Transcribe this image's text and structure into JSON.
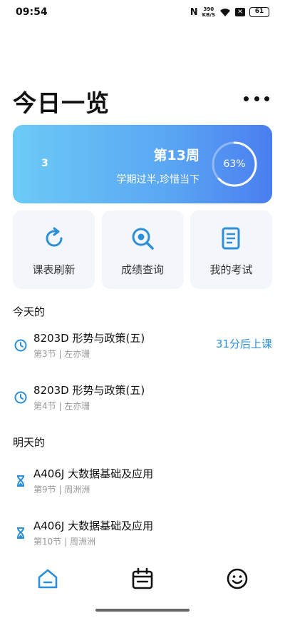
{
  "status_bar": {
    "time": "09:54",
    "nfc": "N",
    "speed_value": "390",
    "speed_unit": "KB/S",
    "battery": "61"
  },
  "page_title": "今日一览",
  "week_card": {
    "left_number": "3",
    "week_label": "第13周",
    "subtitle": "学期过半,珍惜当下",
    "progress_text": "63%",
    "progress_value": 0.63
  },
  "quick_actions": [
    {
      "label": "课表刷新",
      "icon": "refresh-icon"
    },
    {
      "label": "成绩查询",
      "icon": "search-icon"
    },
    {
      "label": "我的考试",
      "icon": "document-icon"
    }
  ],
  "today": {
    "title": "今天的",
    "courses": [
      {
        "name": "8203D 形势与政策(五)",
        "meta": "第3节 | 左亦珊",
        "status": "31分后上课",
        "icon": "clock-icon"
      },
      {
        "name": "8203D 形势与政策(五)",
        "meta": "第4节 | 左亦珊",
        "status": "",
        "icon": "clock-icon"
      }
    ]
  },
  "tomorrow": {
    "title": "明天的",
    "courses": [
      {
        "name": "A406J 大数据基础及应用",
        "meta": "第9节 | 周洲洲",
        "icon": "hourglass-icon"
      },
      {
        "name": "A406J 大数据基础及应用",
        "meta": "第10节 | 周洲洲",
        "icon": "hourglass-icon"
      }
    ]
  },
  "bottom_nav": [
    {
      "name": "home",
      "icon": "home-icon",
      "active": true
    },
    {
      "name": "schedule",
      "icon": "calendar-icon",
      "active": false
    },
    {
      "name": "profile",
      "icon": "smiley-icon",
      "active": false
    }
  ],
  "colors": {
    "accent": "#2d8fd8",
    "card_gradient_start": "#6ccbf6",
    "card_gradient_end": "#4a7ef0",
    "tile_bg": "#f3f7fc"
  }
}
